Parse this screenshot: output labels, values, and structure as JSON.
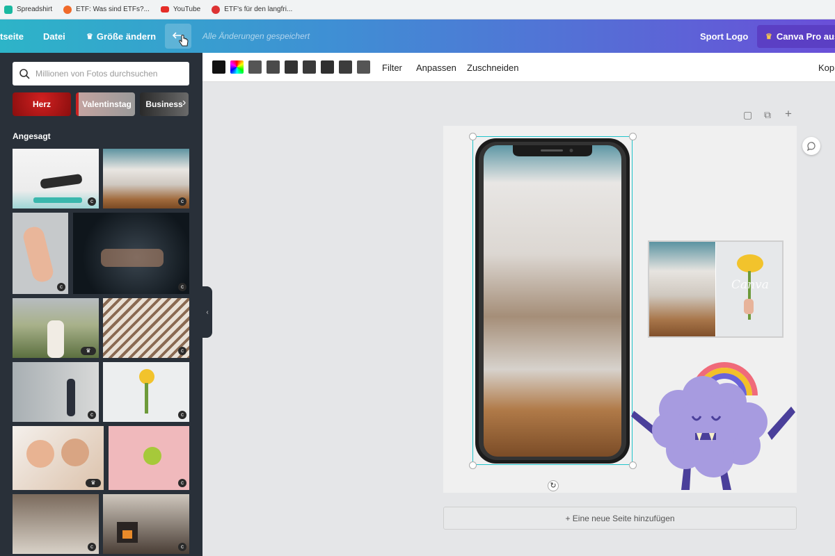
{
  "bookmarks": [
    {
      "label": "Spreadshirt",
      "color": "#1ab8a0"
    },
    {
      "label": "ETF: Was sind ETFs?...",
      "color": "#f06a2a"
    },
    {
      "label": "YouTube",
      "color": "#e52d27"
    },
    {
      "label": "ETF's für den langfri...",
      "color": "#d33"
    }
  ],
  "topbar": {
    "home": "tseite",
    "file": "Datei",
    "resize": "Größe ändern",
    "crown": "♛",
    "saved": "Alle Änderungen gespeichert",
    "title": "Sport Logo",
    "pro": "Canva Pro ausp"
  },
  "sidebar": {
    "search_placeholder": "Millionen von Fotos durchsuchen",
    "chips": [
      "Herz",
      "Valentinstag",
      "Business"
    ],
    "section": "Angesagt",
    "badge_c": "c",
    "badge_crown": "♛",
    "collapse": "‹"
  },
  "toolbar": {
    "swatches": [
      "#111111",
      "rainbow",
      "#555555",
      "#4a4a4a",
      "#333333",
      "#3a3a3a",
      "#2f2f2f",
      "#3c3c3c",
      "#555555"
    ],
    "filter": "Filter",
    "adjust": "Anpassen",
    "crop": "Zuschneiden",
    "copy": "Kopi"
  },
  "canvas": {
    "watermark": "Canva",
    "rotate": "↻",
    "add_page": "+ Eine neue Seite hinzufügen",
    "page_icons": [
      "▢",
      "⧉",
      "+"
    ]
  },
  "colors": {
    "accent": "#20c4cb",
    "sidebar": "#293039",
    "pro": "#5b3fc4"
  }
}
